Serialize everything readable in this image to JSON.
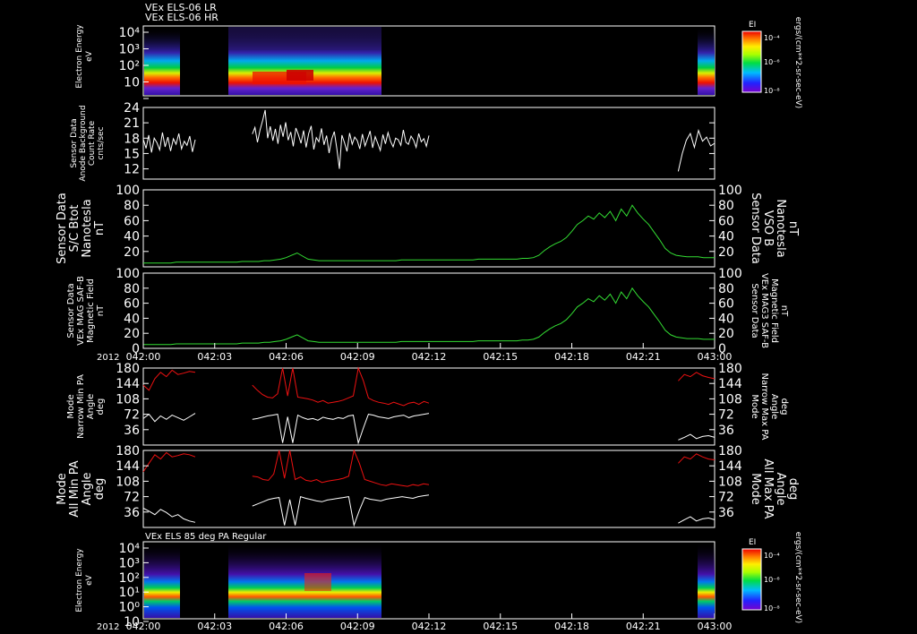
{
  "header": {
    "line1": "VEx ELS-06 LR",
    "line2": "VEx ELS-06 HR"
  },
  "colors": {
    "white": "#ffffff",
    "green": "#33dd33",
    "red": "#ee1111",
    "frame": "#ffffff"
  },
  "time_axis": {
    "year": "2012",
    "tick_labels": [
      "042:00",
      "042:03",
      "042:06",
      "042:09",
      "042:12",
      "042:15",
      "042:18",
      "042:21",
      "043:00"
    ]
  },
  "colorbar": {
    "label": "EI",
    "units": "ergs/(cm**2-sr-sec-eV)",
    "ticks": [
      "10⁻⁴",
      "10⁻⁶",
      "10⁻⁸"
    ]
  },
  "chart_data": [
    {
      "type": "heatmap",
      "title": "",
      "ylabel": [
        "Electron Energy",
        "eV"
      ],
      "y_ticks": [
        "10⁴",
        "10³",
        "10²",
        "10",
        ""
      ],
      "data_intervals_x": [
        [
          0.0,
          0.1
        ],
        [
          0.21,
          0.55
        ],
        [
          1.03,
          1.1
        ]
      ],
      "colorbar": true
    },
    {
      "type": "line",
      "title": "",
      "ylabel": [
        "Sensor Data",
        "Anode Background",
        "Count Rate",
        "cnts/sec"
      ],
      "ylim": [
        10,
        24
      ],
      "y_ticks": [
        "24",
        "21",
        "18",
        "15",
        "12"
      ],
      "series": [
        {
          "color": "#ffffff",
          "segments": [
            {
              "x0": 0.0,
              "x1": 0.1,
              "values": [
                17.8,
                16.0,
                18.6,
                15.2,
                18.0,
                17.1,
                15.7,
                19.1,
                16.3,
                18.2,
                15.5,
                17.9,
                16.8,
                18.9,
                15.9,
                17.4,
                16.6,
                18.4,
                15.3,
                17.7
              ]
            },
            {
              "x0": 0.21,
              "x1": 0.55,
              "values": [
                18.8,
                20.1,
                17.2,
                19.6,
                21.4,
                23.5,
                18.0,
                20.3,
                17.5,
                19.8,
                16.9,
                20.6,
                18.3,
                21.1,
                17.6,
                19.2,
                16.4,
                20.0,
                18.7,
                17.0,
                19.5,
                16.2,
                18.9,
                20.4,
                15.8,
                18.1,
                17.3,
                19.9,
                16.7,
                18.5,
                15.1,
                17.8,
                19.3,
                16.0,
                12.0,
                18.6,
                17.1,
                15.4,
                19.0,
                16.8,
                18.2,
                17.5,
                15.9,
                18.8,
                16.5,
                17.9,
                19.4,
                16.1,
                18.3,
                17.0,
                15.6,
                18.7,
                16.9,
                19.1,
                17.4,
                16.3,
                18.0,
                17.7,
                16.6,
                19.6,
                17.2,
                16.8,
                18.4,
                17.6,
                16.2,
                18.9,
                17.3,
                17.9,
                16.4,
                18.5
              ]
            },
            {
              "x0": 1.03,
              "x1": 1.1,
              "values": [
                11.5,
                15.0,
                17.6,
                18.9,
                16.2,
                19.5,
                17.4,
                18.2,
                16.5,
                17.0
              ]
            }
          ]
        }
      ]
    },
    {
      "type": "line",
      "title": "",
      "ylabel": [
        "Sensor Data",
        "S/C Btot",
        "Nanotesla",
        "nT"
      ],
      "ylabel_right": [
        "Sensor Data",
        "VSO B",
        "Nanotesla",
        "nT"
      ],
      "ylim": [
        0,
        100
      ],
      "y_ticks": [
        "100",
        "80",
        "60",
        "40",
        "20"
      ],
      "series": [
        {
          "color": "#33dd33",
          "segments": [
            {
              "x0": 0.0,
              "x1": 1.1,
              "values": [
                5,
                5,
                5,
                5,
                5,
                5,
                6,
                6,
                6,
                6,
                6,
                6,
                6,
                6,
                6,
                6,
                6,
                6,
                7,
                7,
                7,
                7,
                8,
                8,
                9,
                10,
                12,
                15,
                18,
                14,
                10,
                9,
                8,
                8,
                8,
                8,
                8,
                8,
                8,
                8,
                8,
                8,
                8,
                8,
                8,
                8,
                8,
                9,
                9,
                9,
                9,
                9,
                9,
                9,
                9,
                9,
                9,
                9,
                9,
                9,
                9,
                10,
                10,
                10,
                10,
                10,
                10,
                10,
                10,
                11,
                11,
                12,
                15,
                21,
                26,
                30,
                33,
                38,
                46,
                55,
                60,
                66,
                62,
                70,
                64,
                72,
                60,
                75,
                66,
                80,
                70,
                62,
                55,
                45,
                35,
                24,
                18,
                15,
                14,
                13,
                13,
                13,
                12,
                12,
                12
              ]
            }
          ]
        }
      ]
    },
    {
      "type": "line",
      "title": "",
      "ylabel": [
        "Sensor Data",
        "VEx MAG SAF-B",
        "Magnetic Field",
        "nT"
      ],
      "ylabel_right": [
        "Sensor Data",
        "VEx MAG3 SAF-B",
        "Magnetic Field",
        "nT"
      ],
      "ylim": [
        0,
        100
      ],
      "y_ticks": [
        "100",
        "80",
        "60",
        "40",
        "20",
        "0"
      ],
      "series": [
        {
          "color": "#33dd33",
          "segments": [
            {
              "x0": 0.0,
              "x1": 1.1,
              "values": [
                5,
                5,
                5,
                5,
                5,
                5,
                6,
                6,
                6,
                6,
                6,
                6,
                6,
                6,
                6,
                6,
                6,
                6,
                7,
                7,
                7,
                7,
                8,
                8,
                9,
                10,
                12,
                15,
                18,
                14,
                10,
                9,
                8,
                8,
                8,
                8,
                8,
                8,
                8,
                8,
                8,
                8,
                8,
                8,
                8,
                8,
                8,
                9,
                9,
                9,
                9,
                9,
                9,
                9,
                9,
                9,
                9,
                9,
                9,
                9,
                9,
                10,
                10,
                10,
                10,
                10,
                10,
                10,
                10,
                11,
                11,
                12,
                15,
                21,
                26,
                30,
                33,
                38,
                46,
                55,
                60,
                66,
                62,
                70,
                64,
                72,
                60,
                75,
                66,
                80,
                70,
                62,
                55,
                45,
                35,
                24,
                18,
                15,
                14,
                13,
                13,
                13,
                12,
                12,
                12
              ]
            }
          ]
        }
      ]
    },
    {
      "type": "line",
      "title": "",
      "ylabel": [
        "Mode",
        "Narrow Min PA",
        "Angle",
        "deg"
      ],
      "ylabel_right": [
        "Mode",
        "Narrow Max PA",
        "Angle",
        "deg"
      ],
      "ylim": [
        0,
        180
      ],
      "y_ticks": [
        "180",
        "144",
        "108",
        "72",
        "36"
      ],
      "series": [
        {
          "color": "#ee1111",
          "segments": [
            {
              "x0": 0.0,
              "x1": 0.1,
              "values": [
                140,
                128,
                155,
                170,
                160,
                175,
                165,
                168,
                172,
                170
              ]
            },
            {
              "x0": 0.21,
              "x1": 0.55,
              "values": [
                140,
                128,
                118,
                112,
                110,
                120,
                180,
                115,
                180,
                112,
                110,
                108,
                105,
                100,
                104,
                98,
                100,
                102,
                105,
                110,
                115,
                180,
                150,
                110,
                104,
                100,
                98,
                95,
                100,
                96,
                92,
                98,
                100,
                95,
                102,
                98
              ]
            },
            {
              "x0": 1.03,
              "x1": 1.1,
              "values": [
                150,
                165,
                160,
                170,
                162,
                158,
                155
              ]
            }
          ]
        },
        {
          "color": "#ffffff",
          "segments": [
            {
              "x0": 0.0,
              "x1": 0.1,
              "values": [
                62,
                72,
                55,
                68,
                60,
                70,
                64,
                58,
                66,
                74
              ]
            },
            {
              "x0": 0.21,
              "x1": 0.55,
              "values": [
                60,
                62,
                65,
                68,
                70,
                72,
                5,
                66,
                5,
                70,
                64,
                60,
                62,
                58,
                65,
                62,
                60,
                64,
                62,
                68,
                70,
                5,
                40,
                72,
                70,
                66,
                64,
                62,
                66,
                68,
                70,
                64,
                68,
                70,
                72,
                74
              ]
            },
            {
              "x0": 1.03,
              "x1": 1.1,
              "values": [
                12,
                18,
                25,
                15,
                20,
                22,
                18
              ]
            }
          ]
        }
      ]
    },
    {
      "type": "line",
      "title": "",
      "ylabel": [
        "Mode",
        "All Min PA",
        "Angle",
        "deg"
      ],
      "ylabel_right": [
        "Mode",
        "All Max PA",
        "Angle",
        "deg"
      ],
      "ylim": [
        0,
        180
      ],
      "y_ticks": [
        "180",
        "144",
        "108",
        "72",
        "36"
      ],
      "series": [
        {
          "color": "#ee1111",
          "segments": [
            {
              "x0": 0.0,
              "x1": 0.1,
              "values": [
                130,
                150,
                170,
                160,
                175,
                165,
                168,
                172,
                170,
                165
              ]
            },
            {
              "x0": 0.21,
              "x1": 0.55,
              "values": [
                120,
                118,
                112,
                110,
                125,
                180,
                115,
                180,
                112,
                118,
                110,
                108,
                112,
                105,
                108,
                110,
                112,
                115,
                120,
                180,
                150,
                112,
                108,
                104,
                100,
                98,
                102,
                100,
                98,
                96,
                100,
                98,
                102,
                100
              ]
            },
            {
              "x0": 1.03,
              "x1": 1.1,
              "values": [
                150,
                165,
                160,
                172,
                165,
                160,
                158
              ]
            }
          ]
        },
        {
          "color": "#ffffff",
          "segments": [
            {
              "x0": 0.0,
              "x1": 0.1,
              "values": [
                45,
                38,
                30,
                42,
                35,
                25,
                30,
                20,
                15,
                12
              ]
            },
            {
              "x0": 0.21,
              "x1": 0.55,
              "values": [
                50,
                55,
                60,
                65,
                68,
                70,
                5,
                65,
                5,
                72,
                68,
                65,
                62,
                60,
                64,
                66,
                68,
                70,
                72,
                5,
                40,
                70,
                66,
                64,
                62,
                66,
                68,
                70,
                72,
                70,
                68,
                72,
                74,
                76
              ]
            },
            {
              "x0": 1.03,
              "x1": 1.1,
              "values": [
                10,
                18,
                25,
                15,
                20,
                22,
                18
              ]
            }
          ]
        }
      ]
    },
    {
      "type": "heatmap",
      "title": "VEx ELS 85 deg PA Regular",
      "ylabel": [
        "Electron Energy",
        "eV"
      ],
      "y_ticks": [
        "10⁴",
        "10³",
        "10²",
        "10¹",
        "10⁰",
        "10"
      ],
      "data_intervals_x": [
        [
          0.0,
          0.1
        ],
        [
          0.21,
          0.55
        ],
        [
          1.03,
          1.1
        ]
      ],
      "colorbar": true
    }
  ]
}
